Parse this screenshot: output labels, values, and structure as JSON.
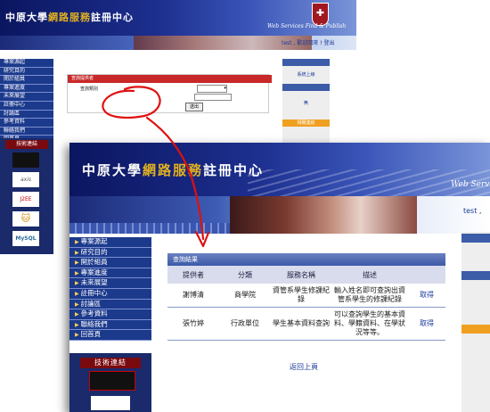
{
  "site": {
    "title_pre": "中原大學",
    "title_hl": "網路服務",
    "title_post": "註冊中心",
    "subtitle": "Web Services Find & Publish",
    "subtitle_short": "Web Servic"
  },
  "header": {
    "user": "test",
    "welcome": "歡迎回來",
    "logout": "登出"
  },
  "menu": {
    "items": [
      "專案源起",
      "研究目的",
      "開於組員",
      "專案進度",
      "未來展望",
      "註冊中心",
      "討論區",
      "參考資料",
      "聯絡我們",
      "回首頁"
    ]
  },
  "tech": {
    "header": "技術連結",
    "logos": [
      "axis",
      "J2EE",
      "MySQL"
    ]
  },
  "query": {
    "header": "查詢提供者",
    "field_label": "查詢類別",
    "select_value": "",
    "button": "送出"
  },
  "right_col": {
    "system": "系統上線",
    "none": "無",
    "related": "相關連結"
  },
  "results": {
    "header": "查詢結果",
    "columns": [
      "提供者",
      "分類",
      "服務名稱",
      "描述",
      ""
    ],
    "rows": [
      {
        "provider": "謝博清",
        "category": "商學院",
        "service": "資管系學生修課紀錄",
        "desc": "輸入姓名即可查詢出資管系學生的修課紀錄",
        "action": "取得"
      },
      {
        "provider": "張竹婷",
        "category": "行政單位",
        "service": "學生基本資料查詢",
        "desc": "可以查詢學生的基本資料、學籍資料、在學狀況等等。",
        "action": "取得"
      }
    ],
    "back_link": "返回上頁"
  },
  "colors": {
    "accent_red": "#e01010",
    "menu_blue": "#1c3a8c",
    "banner_dark": "#0b1660"
  }
}
